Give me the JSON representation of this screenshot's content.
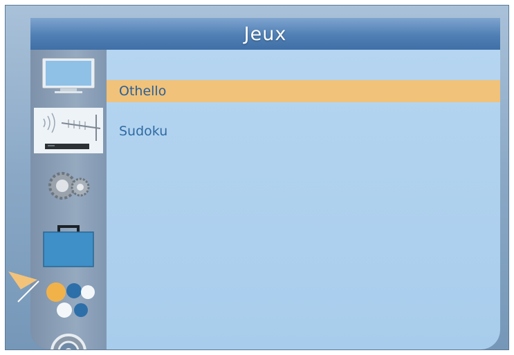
{
  "header": {
    "title": "Jeux"
  },
  "sidebar": {
    "items": [
      {
        "icon": "tv-icon"
      },
      {
        "icon": "antenna-receiver-icon"
      },
      {
        "icon": "gears-icon"
      },
      {
        "icon": "toolbox-icon"
      },
      {
        "icon": "games-balls-icon",
        "active": true
      },
      {
        "icon": "disc-icon"
      }
    ]
  },
  "menu": {
    "items": [
      {
        "label": "Othello",
        "selected": true
      },
      {
        "label": "Sudoku",
        "selected": false
      }
    ]
  },
  "colors": {
    "header": "#4f7fb4",
    "content": "#a8cdec",
    "selected_row": "#f0c27a",
    "text": "#2f6aa3"
  }
}
